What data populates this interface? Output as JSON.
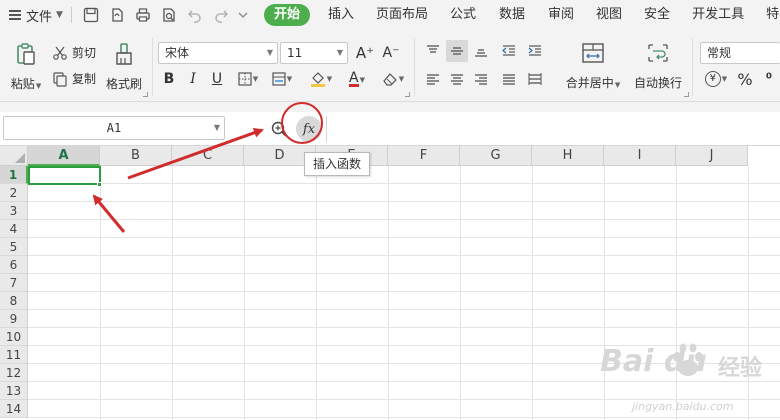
{
  "menubar": {
    "file_label": "文件",
    "tabs": [
      "开始",
      "插入",
      "页面布局",
      "公式",
      "数据",
      "审阅",
      "视图",
      "安全",
      "开发工具",
      "特"
    ],
    "active_tab": "开始",
    "accent_color": "#4cae4c"
  },
  "ribbon": {
    "paste_label": "粘贴",
    "cut_label": "剪切",
    "copy_label": "复制",
    "format_painter_label": "格式刷",
    "font_name": "宋体",
    "font_size": "11",
    "grow_font": "A⁺",
    "shrink_font": "A⁻",
    "bold": "B",
    "italic": "I",
    "underline": "U",
    "font_color_glyph": "A",
    "merge_center_label": "合并居中",
    "wrap_text_label": "自动换行",
    "number_format": "常规",
    "currency_glyph": "¥",
    "percent_glyph": "%",
    "font_color": "#d12c2c",
    "fill_color": "#f2c744"
  },
  "formula_bar": {
    "name_box": "A1",
    "fx_glyph": "fx",
    "tooltip": "插入函数"
  },
  "grid": {
    "columns": [
      "A",
      "B",
      "C",
      "D",
      "E",
      "F",
      "G",
      "H",
      "I",
      "J"
    ],
    "rows": [
      "1",
      "2",
      "3",
      "4",
      "5",
      "6",
      "7",
      "8",
      "9",
      "10",
      "11",
      "12",
      "13",
      "14"
    ],
    "selected_cell": "A1"
  },
  "watermark": {
    "brand": "Bai du",
    "name": "经验",
    "url": "jingyan.baidu.com"
  }
}
